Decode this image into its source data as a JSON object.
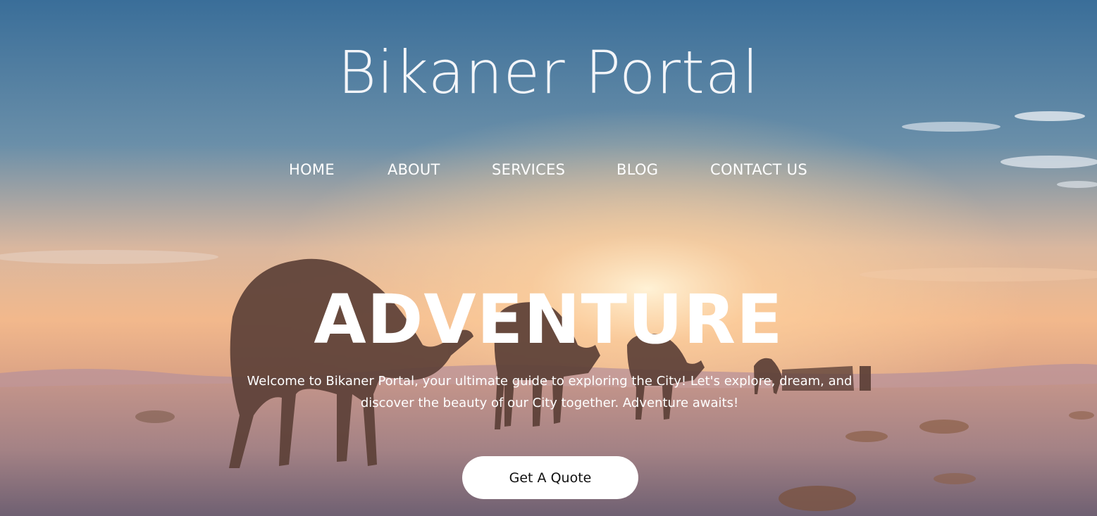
{
  "site": {
    "title": "Bikaner Portal"
  },
  "nav": {
    "items": [
      {
        "label": "HOME"
      },
      {
        "label": "ABOUT"
      },
      {
        "label": "SERVICES"
      },
      {
        "label": "BLOG"
      },
      {
        "label": "CONTACT US"
      }
    ]
  },
  "hero": {
    "headline": "ADVENTURE",
    "intro": "Welcome to Bikaner Portal, your ultimate guide to exploring the City! Let's explore, dream, and discover the beauty of our City together. Adventure awaits!",
    "cta_label": "Get A Quote",
    "background": "desert sunset with camel caravan"
  },
  "colors": {
    "sky_top": "#3b6f9a",
    "horizon_glow": "#f8c28a",
    "sand": "#c99776",
    "cta_bg": "#ffffff",
    "text": "#ffffff"
  }
}
